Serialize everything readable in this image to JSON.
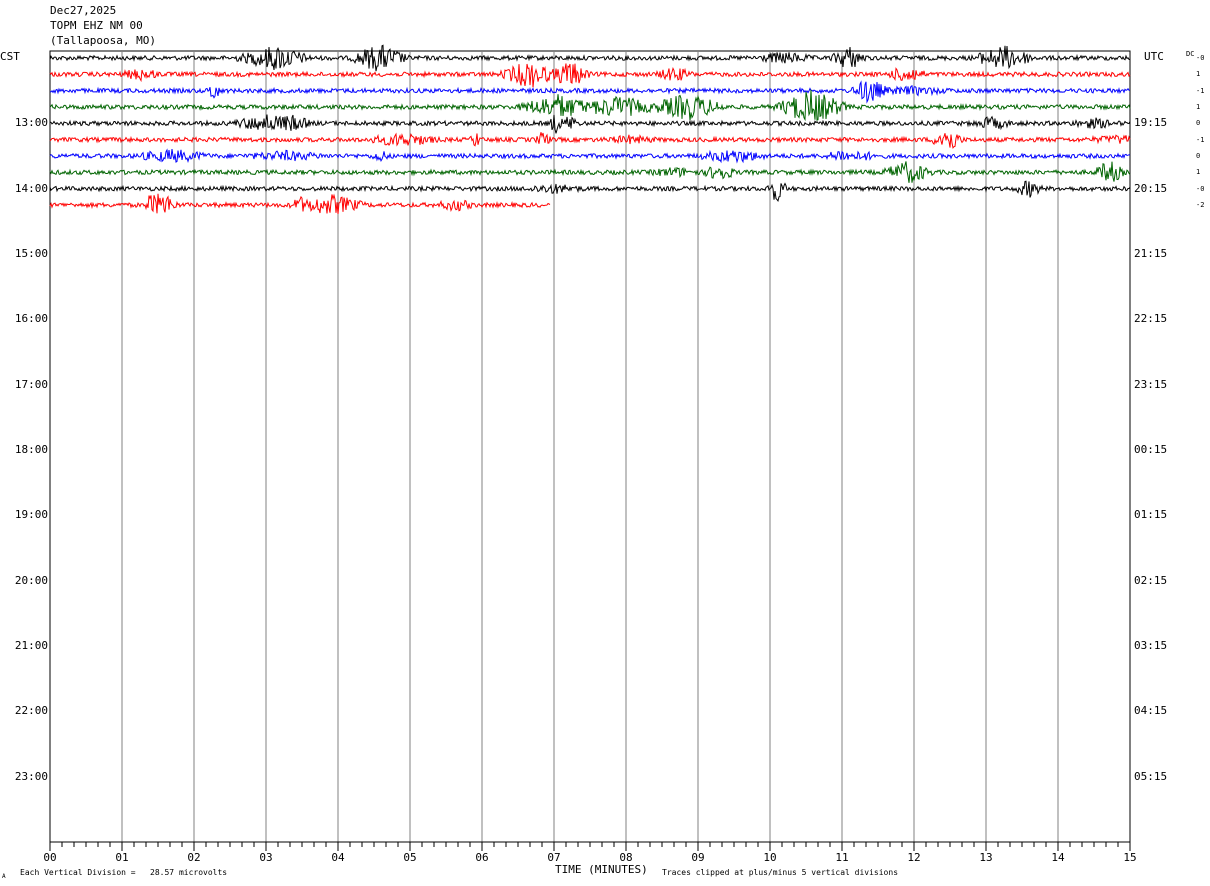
{
  "header": {
    "date": "Dec27,2025",
    "station": "TOPM EHZ NM 00",
    "location": "(Tallapoosa, MO)"
  },
  "tz_left": "CST",
  "tz_right": "UTC",
  "dc_label": "DC",
  "footer": {
    "scale_note": "Each Vertical Division =   28.57 microvolts",
    "clip_note": "Traces clipped at plus/minus 5 vertical divisions",
    "corner_mark": "A"
  },
  "colors": {
    "cycle": [
      "#000000",
      "#ff0000",
      "#0000ff",
      "#006400"
    ],
    "grid": "#808080"
  },
  "chart_data": {
    "type": "line",
    "xlabel": "TIME (MINUTES)",
    "xlim": [
      0,
      15
    ],
    "x_ticks": [
      "00",
      "01",
      "02",
      "03",
      "04",
      "05",
      "06",
      "07",
      "08",
      "09",
      "10",
      "11",
      "12",
      "13",
      "14",
      "15"
    ],
    "rows_per_hour": 4,
    "row_count": 48,
    "left_hour_labels": [
      "13:00",
      "14:00",
      "15:00",
      "16:00",
      "17:00",
      "18:00",
      "19:00",
      "20:00",
      "21:00",
      "22:00",
      "23:00"
    ],
    "right_hour_labels": [
      "19:15",
      "20:15",
      "21:15",
      "22:15",
      "23:15",
      "00:15",
      "01:15",
      "02:15",
      "03:15",
      "04:15",
      "05:15"
    ],
    "traces": [
      {
        "row": 0,
        "end_minute": 15,
        "dc": "-0"
      },
      {
        "row": 1,
        "end_minute": 15,
        "dc": "1"
      },
      {
        "row": 2,
        "end_minute": 15,
        "dc": "-1"
      },
      {
        "row": 3,
        "end_minute": 15,
        "dc": "1"
      },
      {
        "row": 4,
        "end_minute": 15,
        "dc": "0"
      },
      {
        "row": 5,
        "end_minute": 15,
        "dc": "-1"
      },
      {
        "row": 6,
        "end_minute": 15,
        "dc": "0"
      },
      {
        "row": 7,
        "end_minute": 15,
        "dc": "1"
      },
      {
        "row": 8,
        "end_minute": 15,
        "dc": "-0"
      },
      {
        "row": 9,
        "end_minute": 6.95,
        "dc": "-2"
      }
    ]
  }
}
